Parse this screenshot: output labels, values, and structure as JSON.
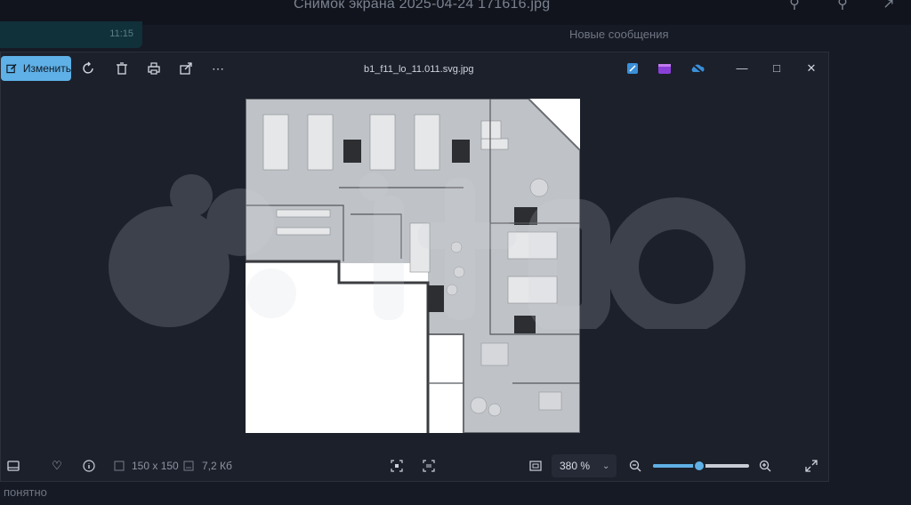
{
  "background_app": {
    "title": "Снимок экрана 2025-04-24 171616.jpg",
    "right_text": "Новые сообщения",
    "left_strip_text": "11:15",
    "bottom_text": "понятно"
  },
  "viewer": {
    "toolbar": {
      "edit_label": "Изменить",
      "file_name": "b1_f11_lo_11.011.svg.jpg"
    },
    "status": {
      "dimensions": "150 x 150",
      "file_size": "7,2 Кб",
      "zoom_value": "380 %",
      "zoom_slider_fraction": 0.48
    }
  },
  "colors": {
    "accent": "#5fb0e6",
    "viewer_bg": "#1c202b",
    "page_bg": "#161a24"
  },
  "icons": [
    "rotate-icon",
    "delete-icon",
    "print-icon",
    "share-icon",
    "more-icon",
    "minimize-icon",
    "maximize-icon",
    "close-icon",
    "film-strip-icon",
    "favorite-icon",
    "info-icon",
    "fit-icon",
    "actual-size-icon",
    "zoom-out-icon",
    "zoom-in-icon",
    "fullscreen-icon"
  ]
}
